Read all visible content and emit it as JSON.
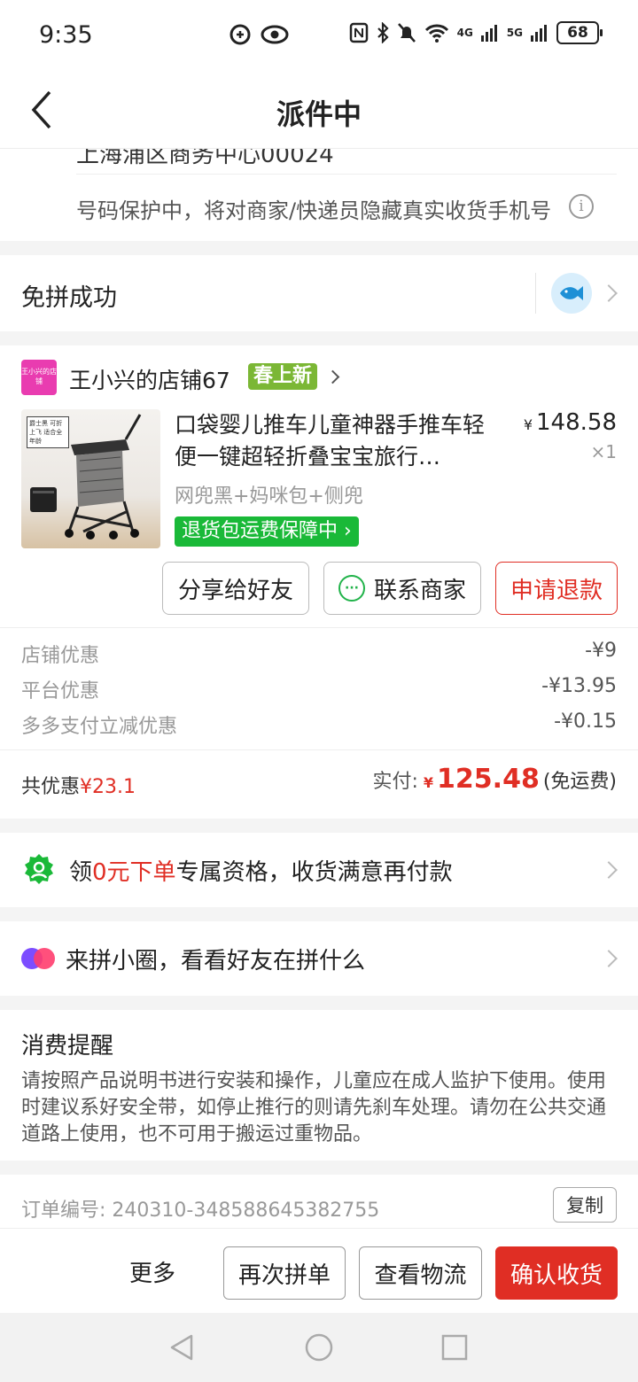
{
  "status_bar": {
    "time": "9:35",
    "battery": "68",
    "net1": "4G",
    "net2": "5G"
  },
  "nav": {
    "title": "派件中"
  },
  "address": {
    "cut_text": "上海浦区商务中心00024",
    "privacy_note": "号码保护中，将对商家/快递员隐藏真实收货手机号"
  },
  "group": {
    "status": "免拼成功"
  },
  "shop": {
    "logo_text": "王小兴的店铺",
    "name": "王小兴的店铺67",
    "badge": "春上新"
  },
  "product": {
    "title": "口袋婴儿推车儿童神器手推车轻便一键超轻折叠宝宝旅行…",
    "price_symbol": "¥",
    "price": "148.58",
    "quantity": "×1",
    "spec": "网兜黑+妈咪包+侧兜",
    "guarantee_tag": "退货包运费保障中",
    "image_label": "爵士黑 可折上飞 适合全年龄"
  },
  "actions": {
    "share": "分享给好友",
    "contact": "联系商家",
    "refund": "申请退款"
  },
  "discounts": [
    {
      "label": "店铺优惠",
      "value": "-¥9"
    },
    {
      "label": "平台优惠",
      "value": "-¥13.95"
    },
    {
      "label": "多多支付立减优惠",
      "value": "-¥0.15"
    }
  ],
  "totals": {
    "discount_label": "共优惠",
    "discount_value": "¥23.1",
    "paid_label": "实付:",
    "paid_symbol": "¥",
    "paid_amount": "125.48",
    "shipping_note": "(免运费)"
  },
  "promo": {
    "prefix": "领",
    "highlight": "0元下单",
    "suffix": "专属资格，收货满意再付款"
  },
  "circle": {
    "text": "来拼小圈，看看好友在拼什么"
  },
  "notice": {
    "title": "消费提醒",
    "body": "请按照产品说明书进行安装和操作，儿童应在成人监护下使用。使用时建议系好安全带，如停止推行的则请先刹车处理。请勿在公共交通道路上使用，也不可用于搬运过重物品。"
  },
  "order": {
    "label": "订单编号:",
    "number": "240310-348588645382755",
    "copy": "复制"
  },
  "bottom_bar": {
    "more": "更多",
    "regroup": "再次拼单",
    "logistics": "查看物流",
    "confirm": "确认收货"
  },
  "colors": {
    "accent_red": "#e02e24",
    "green_tag": "#1ab938",
    "badge_green": "#7bb735",
    "shop_logo": "#e93cb0"
  },
  "icons": [
    "back-arrow-icon",
    "info-icon",
    "fish-avatar-icon",
    "chevron-right-icon",
    "wechat-icon",
    "badge-check-icon",
    "circle-logo-icon",
    "nav-back-icon",
    "nav-home-icon",
    "nav-recent-icon"
  ]
}
